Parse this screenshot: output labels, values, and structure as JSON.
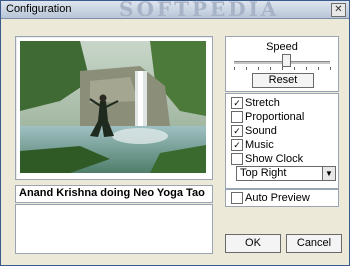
{
  "window": {
    "title": "Configuration",
    "watermark": "SOFTPEDIA"
  },
  "preview": {
    "caption": "Anand Krishna doing Neo Yoga Tao"
  },
  "speed": {
    "label": "Speed",
    "level": 0.55,
    "reset_label": "Reset"
  },
  "options": {
    "items": [
      {
        "label": "Stretch",
        "checked": true
      },
      {
        "label": "Proportional",
        "checked": false
      },
      {
        "label": "Sound",
        "checked": true
      },
      {
        "label": "Music",
        "checked": true
      },
      {
        "label": "Show Clock",
        "checked": false
      }
    ],
    "clock_position": "Top Right"
  },
  "auto_preview": {
    "label": "Auto Preview",
    "checked": false
  },
  "buttons": {
    "ok": "OK",
    "cancel": "Cancel"
  }
}
